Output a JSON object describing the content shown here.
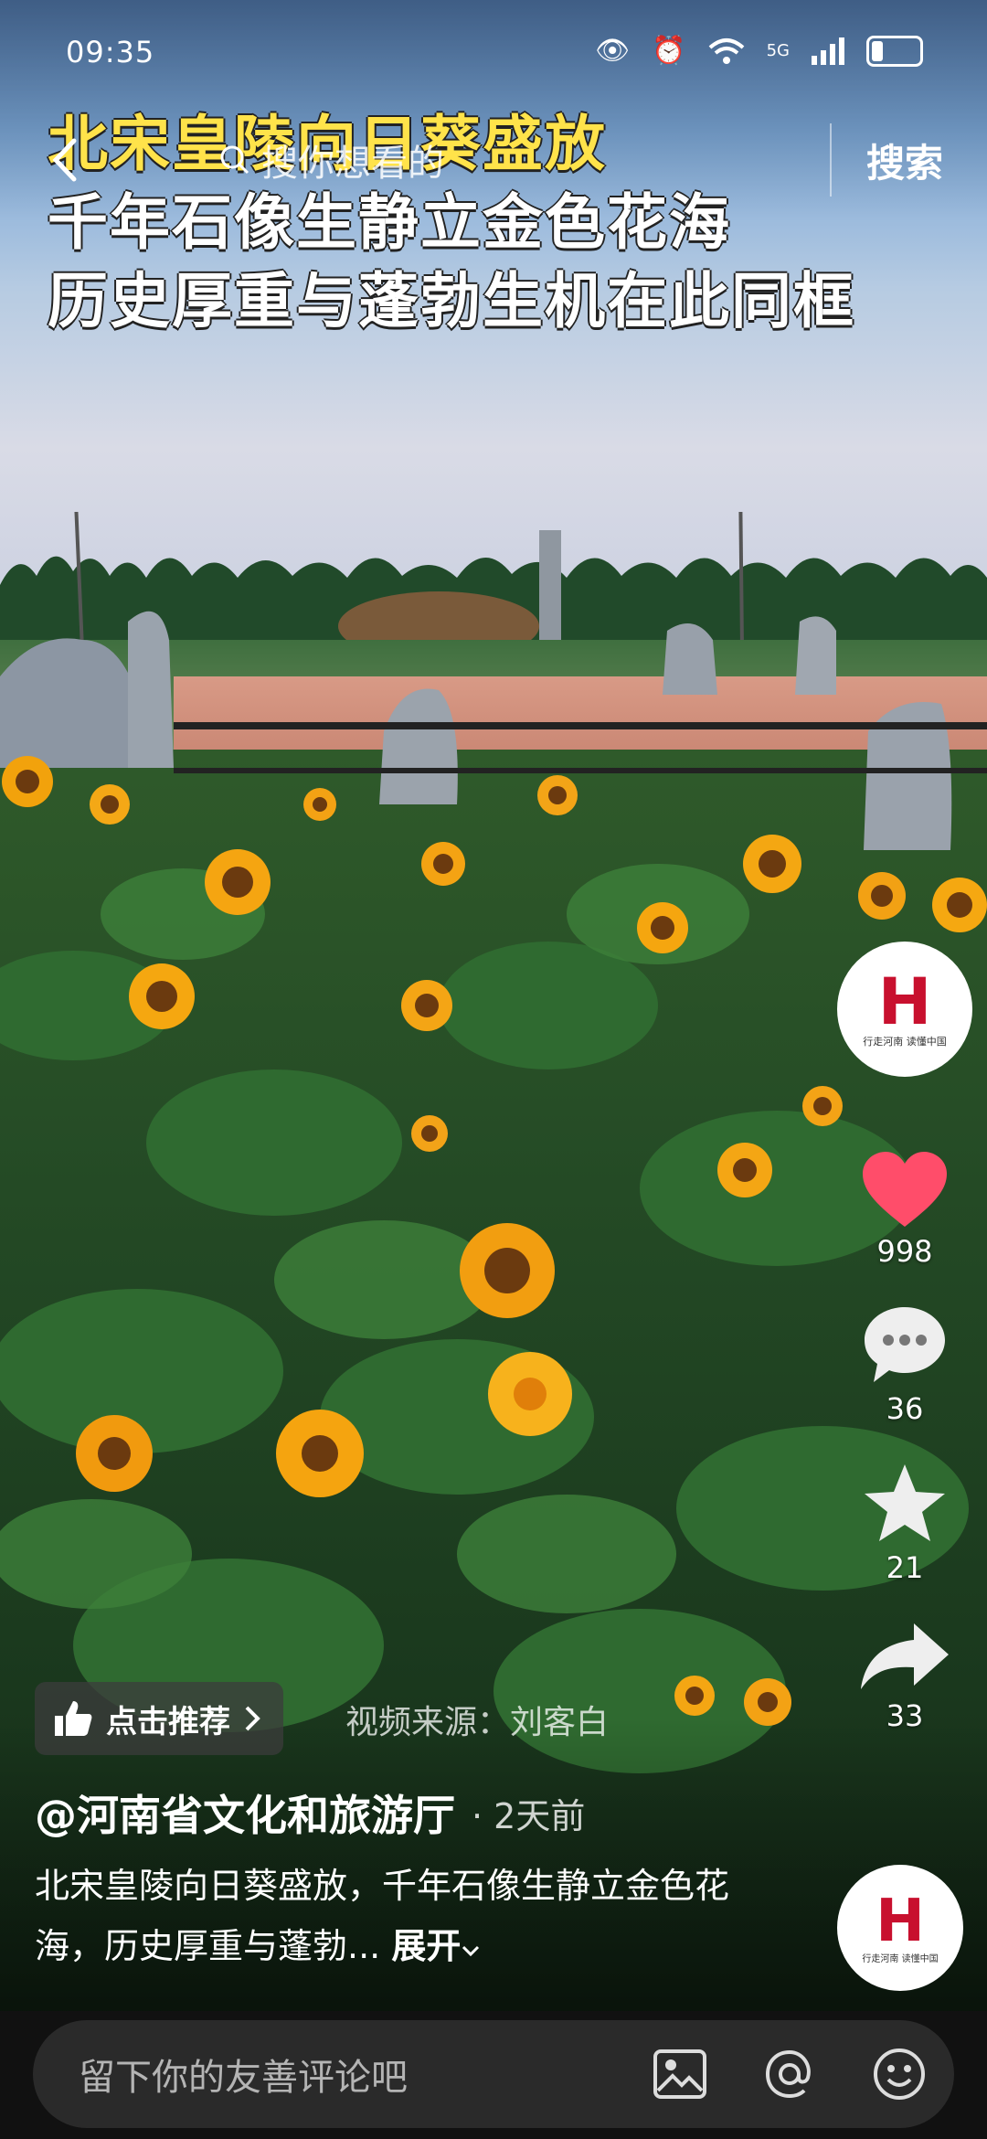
{
  "status_bar": {
    "time": "09:35",
    "signal_label": "5G"
  },
  "overlay_title": {
    "line1": "北宋皇陵向日葵盛放",
    "line2": "千年石像生静立金色花海",
    "line3": "历史厚重与蓬勃生机在此同框"
  },
  "search": {
    "placeholder": "搜你想看的",
    "button_label": "搜索"
  },
  "actions": {
    "likes": "998",
    "comments": "36",
    "favorites": "21",
    "shares": "33"
  },
  "avatar": {
    "mark": "H",
    "tagline": "行走河南 读懂中国"
  },
  "recommend_label": "点击推荐",
  "video_source": "视频来源：刘客白",
  "post": {
    "author": "@河南省文化和旅游厅",
    "time": "· 2天前",
    "description": "北宋皇陵向日葵盛放，千年石像生静立金色花海，历史厚重与蓬勃...",
    "expand_label": "展开"
  },
  "comment": {
    "placeholder": "留下你的友善评论吧"
  },
  "colors": {
    "like": "#ff4d6a",
    "title_yellow": "#ffe34a",
    "brand_red": "#c8102e"
  }
}
